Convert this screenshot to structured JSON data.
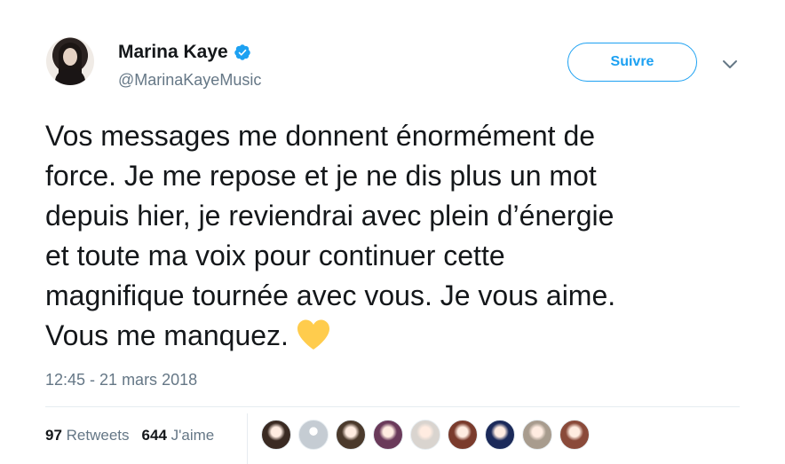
{
  "author": {
    "name": "Marina Kaye",
    "handle": "@MarinaKayeMusic",
    "verified_icon": "verified-badge-icon",
    "verified_color": "#1da1f2"
  },
  "actions": {
    "follow_label": "Suivre",
    "menu_icon": "chevron-down-icon"
  },
  "tweet": {
    "text": "Vos messages me donnent énormément de\nforce. Je me repose et je ne dis plus un mot\ndepuis hier, je reviendrai avec plein d’énergie\net toute ma voix pour continuer cette\nmagnifique tournée avec vous. Je vous aime.\nVous me manquez.",
    "emoji_icon": "yellow-heart-icon",
    "emoji_color": "#ffcc4d",
    "timestamp": "12:45 - 21 mars 2018"
  },
  "stats": {
    "retweets_count": "97",
    "retweets_label": "Retweets",
    "likes_count": "644",
    "likes_label": "J'aime"
  },
  "likers": [
    {
      "icon": "liker-avatar-icon",
      "color": "#3a2a22"
    },
    {
      "icon": "default-avatar-icon",
      "color": "#c5ccd3"
    },
    {
      "icon": "liker-avatar-icon",
      "color": "#4b3a2c"
    },
    {
      "icon": "liker-avatar-icon",
      "color": "#6a3a5a"
    },
    {
      "icon": "liker-avatar-icon",
      "color": "#d9d4cf"
    },
    {
      "icon": "liker-avatar-icon",
      "color": "#7a3b2c"
    },
    {
      "icon": "liker-avatar-icon",
      "color": "#1b2a5a"
    },
    {
      "icon": "liker-avatar-icon",
      "color": "#a89c8e"
    },
    {
      "icon": "liker-avatar-icon",
      "color": "#8a4a3a"
    }
  ],
  "colors": {
    "text": "#14171a",
    "secondary": "#657786",
    "accent": "#1da1f2",
    "divider": "#e6ecf0"
  }
}
